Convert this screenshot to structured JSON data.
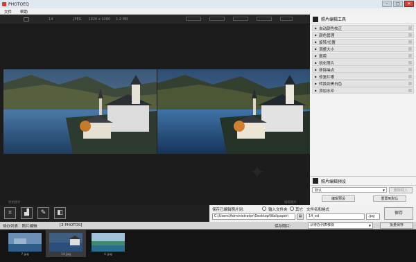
{
  "window": {
    "title": "PHOTOEQ",
    "controls": {
      "min": "–",
      "max": "□",
      "close": "✕"
    }
  },
  "menu": [
    "文件",
    "帮助"
  ],
  "info": {
    "index": "14",
    "format": ".JPEG",
    "dimensions": "1920 x 1080",
    "size": "1.2 MB"
  },
  "viewer": {
    "left_label": "原始图片",
    "right_label": "编辑图片"
  },
  "tools_panel": {
    "title": "照片编辑工具",
    "tools": [
      "自动颜色校正",
      "颜色管理",
      "旋转/位置",
      "调整大小",
      "裁剪",
      "锐化照片",
      "移除噪点",
      "修复红眼",
      "转换到黑白色",
      "添加水印"
    ]
  },
  "presets_panel": {
    "title": "照片编辑预设",
    "selected": "默认",
    "delete_label": "删除载入",
    "edit_label": "编辑预设",
    "reset_label": "重置到默认"
  },
  "save": {
    "save_to_label": "保存已编辑照片到:",
    "option_input": "输入文件夹",
    "option_other": "其它",
    "path": "C:\\Users\\Administrator\\Desktop\\Wallpaper\\",
    "filename_label": "文件名和格式",
    "filename": "14_ed",
    "format": ".jpg",
    "save_button": "保存"
  },
  "queue": {
    "label": "待办列表：照片编辑",
    "count": "[3 PHOTOS]",
    "save_photos_label": "保存照片:",
    "save_option": "从待办列表移除",
    "batch_label": "批量保存"
  },
  "thumbnails": [
    {
      "name": "7.jpg"
    },
    {
      "name": "14.jpg"
    },
    {
      "name": "ri.jpg"
    }
  ],
  "icons": {
    "tool1": "crop-icon",
    "tool2": "histogram-icon",
    "tool3": "eyedropper-icon",
    "tool4": "compare-icon"
  }
}
